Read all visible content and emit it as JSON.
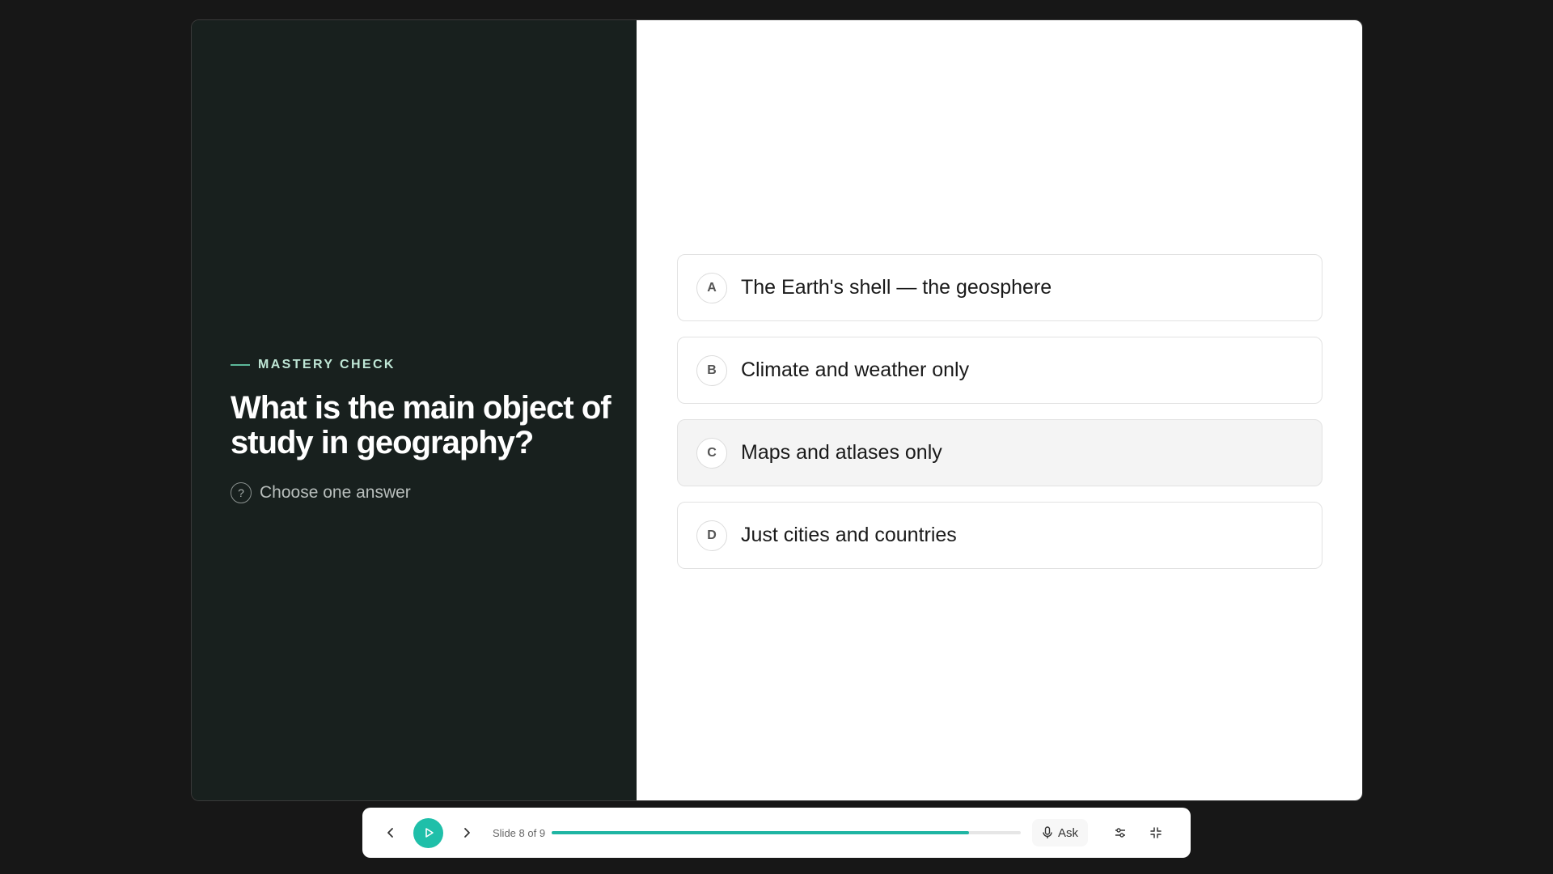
{
  "eyebrow": "MASTERY CHECK",
  "question": "What is the main object of study in geography?",
  "hint": "Choose one answer",
  "options": [
    {
      "letter": "A",
      "text": "The Earth's shell — the geosphere"
    },
    {
      "letter": "B",
      "text": "Climate and weather only"
    },
    {
      "letter": "C",
      "text": "Maps and atlases only"
    },
    {
      "letter": "D",
      "text": "Just cities and countries"
    }
  ],
  "controls": {
    "slide_counter": "Slide 8 of 9",
    "progress_fraction": 0.89,
    "ask_label": "Ask"
  },
  "icons": {
    "prev": "chevron-left-icon",
    "play": "play-icon",
    "next": "chevron-right-icon",
    "mic": "microphone-icon",
    "settings": "sliders-icon",
    "exit_fullscreen": "minimize-icon",
    "hint": "question-circle-icon"
  },
  "colors": {
    "accent": "#1fbfa9",
    "left_panel_bg": "#18201e",
    "eyebrow": "#bfe7d6"
  }
}
